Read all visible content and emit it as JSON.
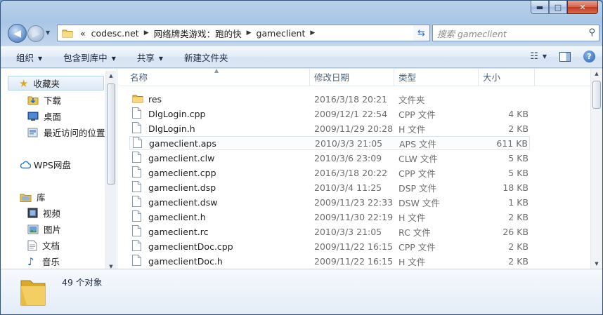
{
  "window": {
    "caption": {
      "minimize": "▬",
      "maximize": "□",
      "close": "✕"
    }
  },
  "address": {
    "overflow": "«",
    "crumbs": [
      "codesc.net",
      "网络牌类游戏：跑的快",
      "gameclient"
    ],
    "search_placeholder": "搜索 gameclient"
  },
  "toolbar": {
    "organize": "组织",
    "include_in_library": "包含到库中",
    "share": "共享",
    "new_folder": "新建文件夹"
  },
  "navpane": {
    "favorites": "收藏夹",
    "downloads": "下载",
    "desktop": "桌面",
    "recent": "最近访问的位置",
    "wps": "WPS网盘",
    "libraries": "库",
    "videos": "视频",
    "pictures": "图片",
    "documents": "文档",
    "music": "音乐"
  },
  "columns": {
    "name": "名称",
    "date": "修改日期",
    "type": "类型",
    "size": "大小"
  },
  "files": [
    {
      "name": "res",
      "date": "2016/3/18 20:21",
      "type": "文件夹",
      "size": "",
      "icon": "folder"
    },
    {
      "name": "DlgLogin.cpp",
      "date": "2009/12/1 22:54",
      "type": "CPP 文件",
      "size": "4 KB",
      "icon": "file"
    },
    {
      "name": "DlgLogin.h",
      "date": "2009/11/29 20:28",
      "type": "H 文件",
      "size": "2 KB",
      "icon": "file"
    },
    {
      "name": "gameclient.aps",
      "date": "2010/3/3 21:05",
      "type": "APS 文件",
      "size": "611 KB",
      "icon": "file"
    },
    {
      "name": "gameclient.clw",
      "date": "2010/3/6 23:09",
      "type": "CLW 文件",
      "size": "5 KB",
      "icon": "file"
    },
    {
      "name": "gameclient.cpp",
      "date": "2016/3/18 20:22",
      "type": "CPP 文件",
      "size": "5 KB",
      "icon": "file"
    },
    {
      "name": "gameclient.dsp",
      "date": "2010/3/4 11:25",
      "type": "DSP 文件",
      "size": "18 KB",
      "icon": "file"
    },
    {
      "name": "gameclient.dsw",
      "date": "2009/11/23 22:33",
      "type": "DSW 文件",
      "size": "1 KB",
      "icon": "file"
    },
    {
      "name": "gameclient.h",
      "date": "2009/11/30 22:19",
      "type": "H 文件",
      "size": "2 KB",
      "icon": "file"
    },
    {
      "name": "gameclient.rc",
      "date": "2010/3/3 21:05",
      "type": "RC 文件",
      "size": "26 KB",
      "icon": "file"
    },
    {
      "name": "gameclientDoc.cpp",
      "date": "2009/11/22 16:15",
      "type": "CPP 文件",
      "size": "2 KB",
      "icon": "file"
    },
    {
      "name": "gameclientDoc.h",
      "date": "2009/11/22 16:15",
      "type": "H 文件",
      "size": "2 KB",
      "icon": "file"
    }
  ],
  "hovered_row": 3,
  "details": {
    "item_count": "49 个对象"
  }
}
